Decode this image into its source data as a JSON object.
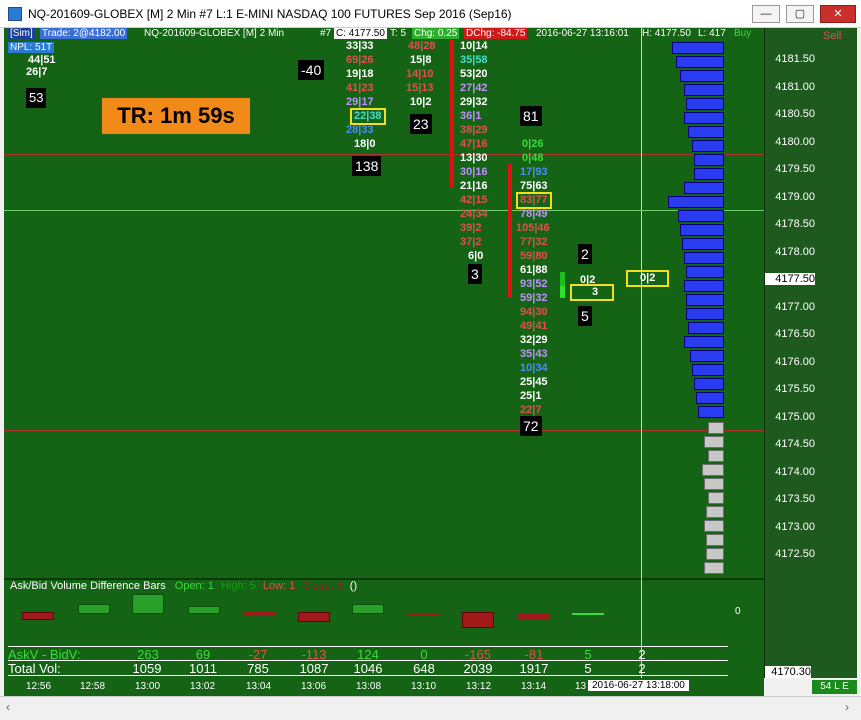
{
  "window": {
    "title": "NQ-201609-GLOBEX [M]  2 Min   #7  L:1  E-MINI NASDAQ 100 FUTURES Sep 2016 (Sep16)",
    "minimize": "—",
    "maximize": "▢",
    "close": "✕"
  },
  "header": {
    "sim": "[Sim]",
    "trade": "Trade: 2@4182.00",
    "symbol": "NQ-201609-GLOBEX [M]  2 Min",
    "bar": "#7",
    "close": "C: 4177.50",
    "t": "T: 5",
    "chg": "Chg: 0.25",
    "dchg": "DChg: -84.75",
    "datetime": "2016-06-27 13:16:01",
    "high": "H: 4177.50",
    "low": "L: 417",
    "buy": "Buy",
    "sell": "Sell",
    "npl": "NPL: 51T"
  },
  "overlay": {
    "tr_label": "TR: 1m 59s",
    "left_top": "44|51",
    "left_second": "26|7",
    "box_53": "53",
    "box_neg40": "-40",
    "box_138": "138",
    "box_23": "23",
    "box_81": "81",
    "box_3": "3",
    "box_2": "2",
    "box_5": "5",
    "box_72": "72"
  },
  "footprint": {
    "col1": [
      "33|33",
      "69|26",
      "19|18",
      "41|23",
      "29|17",
      "22|38",
      "28|33",
      "18|0"
    ],
    "col2": [
      "48|28",
      "15|8",
      "14|10",
      "15|13",
      "10|2"
    ],
    "col3": [
      "10|14",
      "35|58",
      "53|20",
      "27|42",
      "29|32",
      "36|1",
      "38|29",
      "47|16",
      "13|30",
      "30|16",
      "21|16",
      "42|15",
      "24|34",
      "39|2",
      "37|2",
      "6|0"
    ],
    "col4": [
      "0|26",
      "0|48",
      "17|93",
      "75|63",
      "83|77",
      "78|49",
      "105|46",
      "77|32",
      "59|80",
      "61|88",
      "93|52",
      "59|32",
      "94|30",
      "49|41",
      "32|29",
      "35|43",
      "10|34",
      "25|45",
      "25|1",
      "22|7"
    ],
    "col5": [
      "0|2",
      "3"
    ],
    "col6": [
      "0|2"
    ]
  },
  "price_scale": {
    "ticks": [
      "4181.50",
      "4181.00",
      "4180.50",
      "4180.00",
      "4179.50",
      "4179.00",
      "4178.50",
      "4178.00",
      "4177.50",
      "4177.00",
      "4176.50",
      "4176.00",
      "4175.50",
      "4175.00",
      "4174.50",
      "4174.00",
      "4173.50",
      "4173.00",
      "4172.50"
    ],
    "current": "4177.50",
    "bottom_value": "4170.30",
    "mode": "54 L E"
  },
  "indicator": {
    "name": "Ask/Bid Volume Difference Bars",
    "open_label": "Open: 1",
    "high_label": "High: 5",
    "low_label": "Low: 1",
    "close_label": "Close: 5",
    "close_val": "()",
    "zero": "0",
    "askv_label": "AskV - BidV:",
    "total_label": "Total Vol:",
    "askv_values": [
      "263",
      "69",
      "-27",
      "-113",
      "124",
      "0",
      "-165",
      "-81",
      "5",
      "2"
    ],
    "total_values": [
      "1059",
      "1011",
      "785",
      "1087",
      "1046",
      "648",
      "2039",
      "1917",
      "5",
      "2"
    ]
  },
  "time_axis": {
    "labels": [
      "12:56",
      "12:58",
      "13:00",
      "13:02",
      "13:04",
      "13:06",
      "13:08",
      "13:10",
      "13:12",
      "13:14",
      "13"
    ],
    "cursor": "2016-06-27  13:18:00"
  },
  "colors": {
    "chart_bg": "#156315",
    "ask_red": "#e05050",
    "bid_cyan": "#44ddcc",
    "volume_profile": "#2a3cf0",
    "tr_orange": "#f28a1a"
  }
}
